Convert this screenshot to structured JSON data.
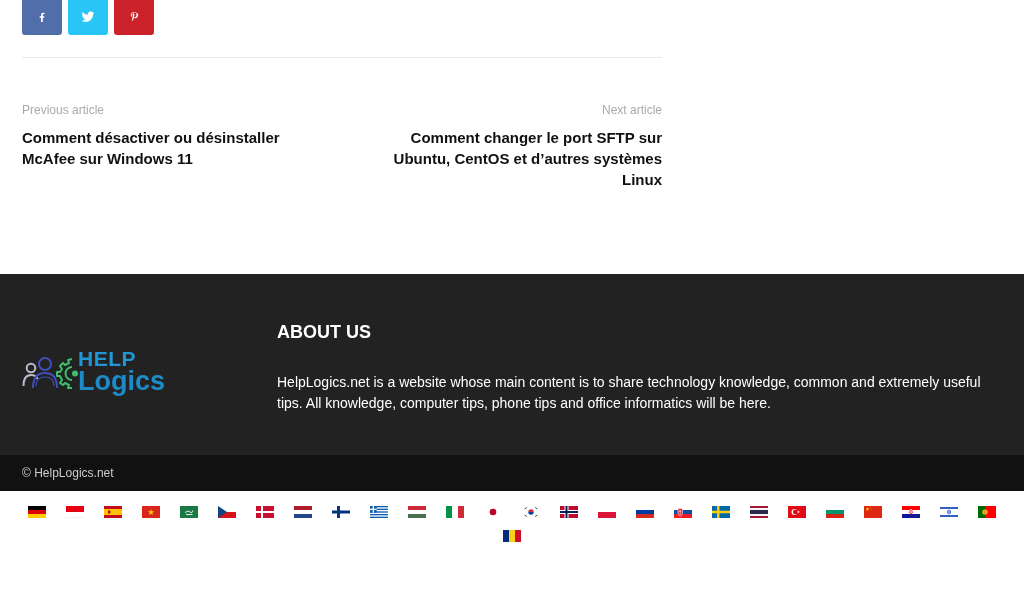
{
  "share_buttons": [
    {
      "kind": "facebook"
    },
    {
      "kind": "twitter"
    },
    {
      "kind": "pinterest"
    }
  ],
  "article_navigation": {
    "previous": {
      "label": "Previous article",
      "title": "Comment désactiver ou désinstaller McAfee sur Windows 11"
    },
    "next": {
      "label": "Next article",
      "title": "Comment changer le port SFTP sur Ubuntu, CentOS et d’autres systèmes Linux"
    }
  },
  "footer": {
    "logo": {
      "upper": "HELP",
      "lower": "Logics"
    },
    "about": {
      "heading": "ABOUT US",
      "text": "HelpLogics.net is a website whose main content is to share technology knowledge, common and extremely useful tips. All knowledge, computer tips, phone tips and office informatics will be here."
    }
  },
  "copyright": "© HelpLogics.net",
  "language_flags": [
    {
      "kind": "germany"
    },
    {
      "kind": "indonesia"
    },
    {
      "kind": "spain"
    },
    {
      "kind": "vietnam"
    },
    {
      "kind": "saudi"
    },
    {
      "kind": "czechia"
    },
    {
      "kind": "denmark"
    },
    {
      "kind": "netherlands"
    },
    {
      "kind": "finland"
    },
    {
      "kind": "greece"
    },
    {
      "kind": "hungary"
    },
    {
      "kind": "italy"
    },
    {
      "kind": "japan"
    },
    {
      "kind": "korea"
    },
    {
      "kind": "norway"
    },
    {
      "kind": "poland"
    },
    {
      "kind": "russia"
    },
    {
      "kind": "slovakia"
    },
    {
      "kind": "sweden"
    },
    {
      "kind": "thailand"
    },
    {
      "kind": "turkey"
    },
    {
      "kind": "bulgaria"
    },
    {
      "kind": "china"
    },
    {
      "kind": "croatia"
    },
    {
      "kind": "israel"
    },
    {
      "kind": "portugal"
    },
    {
      "kind": "romania"
    }
  ]
}
